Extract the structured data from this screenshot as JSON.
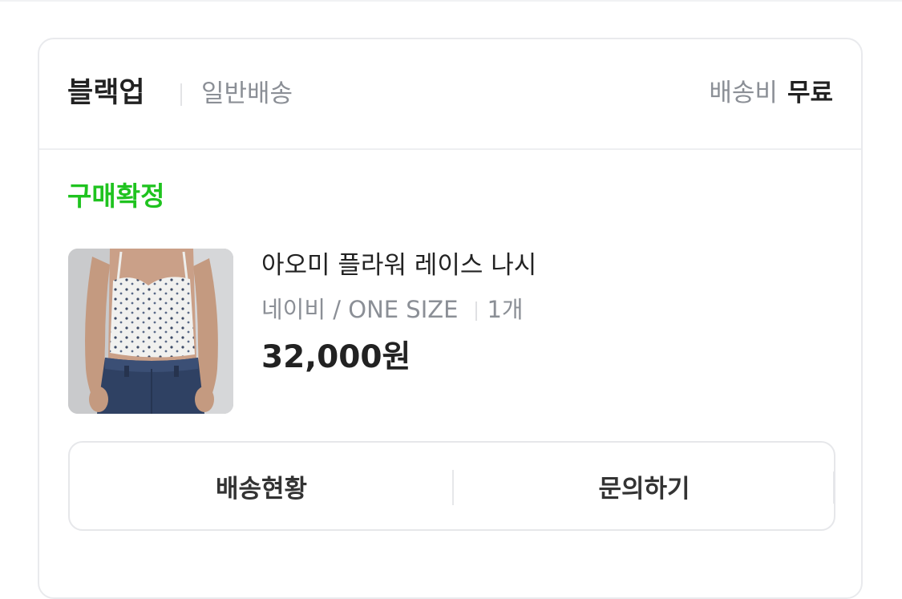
{
  "store": {
    "name": "블랙업",
    "shipping_type": "일반배송",
    "shipping_fee_label": "배송비",
    "shipping_fee_value": "무료"
  },
  "order": {
    "status": "구매확정",
    "status_color": "#1fc31f"
  },
  "product": {
    "image": "product-thumbnail",
    "name": "아오미 플라워 레이스 나시",
    "option": "네이비 / ONE SIZE",
    "quantity": "1개",
    "price": "32,000원"
  },
  "actions": {
    "track_label": "배송현황",
    "inquiry_label": "문의하기"
  }
}
